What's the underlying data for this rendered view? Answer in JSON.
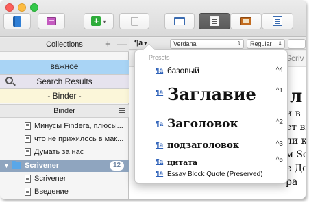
{
  "toolbar": {
    "buttons": [
      "notebook",
      "index-cards",
      "add",
      "trash",
      "composition",
      "editor",
      "corkboard",
      "outliner"
    ]
  },
  "format_bar": {
    "paragraph_label": "¶a",
    "font": "Verdana",
    "style": "Regular"
  },
  "sidebar": {
    "collections_title": "Collections",
    "add_label": "+",
    "remove_label": "—",
    "tabs": [
      {
        "label": "важное"
      },
      {
        "label": "Search Results"
      },
      {
        "label": "- Binder -"
      }
    ],
    "binder_title": "Binder",
    "items": [
      {
        "label": "Минусы Findera, плюсы..."
      },
      {
        "label": "что не прижилось в мак..."
      },
      {
        "label": "Думать за нас"
      }
    ],
    "folder": {
      "label": "Scrivener",
      "count": "12"
    },
    "children": [
      {
        "label": "Scrivener"
      },
      {
        "label": "Введение"
      }
    ]
  },
  "editor": {
    "header_text": "Scriv",
    "big_text": "л",
    "lines": [
      "и в",
      "ет вы",
      "ли к",
      "м Scr",
      "е Док",
      "ра"
    ]
  },
  "presets": {
    "title": "Presets",
    "icon": "¶a",
    "items": [
      {
        "label": "базовый",
        "shortcut": "^4"
      },
      {
        "label": "Заглавие",
        "shortcut": "^1"
      },
      {
        "label": "Заголовок",
        "shortcut": "^2"
      },
      {
        "label": "подзаголовок",
        "shortcut": "^3"
      },
      {
        "label": "цитата",
        "shortcut": "^5"
      },
      {
        "label": "Essay Block Quote (Preserved)",
        "shortcut": ""
      }
    ]
  },
  "colors": {
    "important_tab": "#a9d4f5",
    "search_tab": "#e6e3ee",
    "binder_tab": "#fbf6d9",
    "selected_row": "#8fa5bf",
    "folder_icon": "#5aa7e8"
  }
}
